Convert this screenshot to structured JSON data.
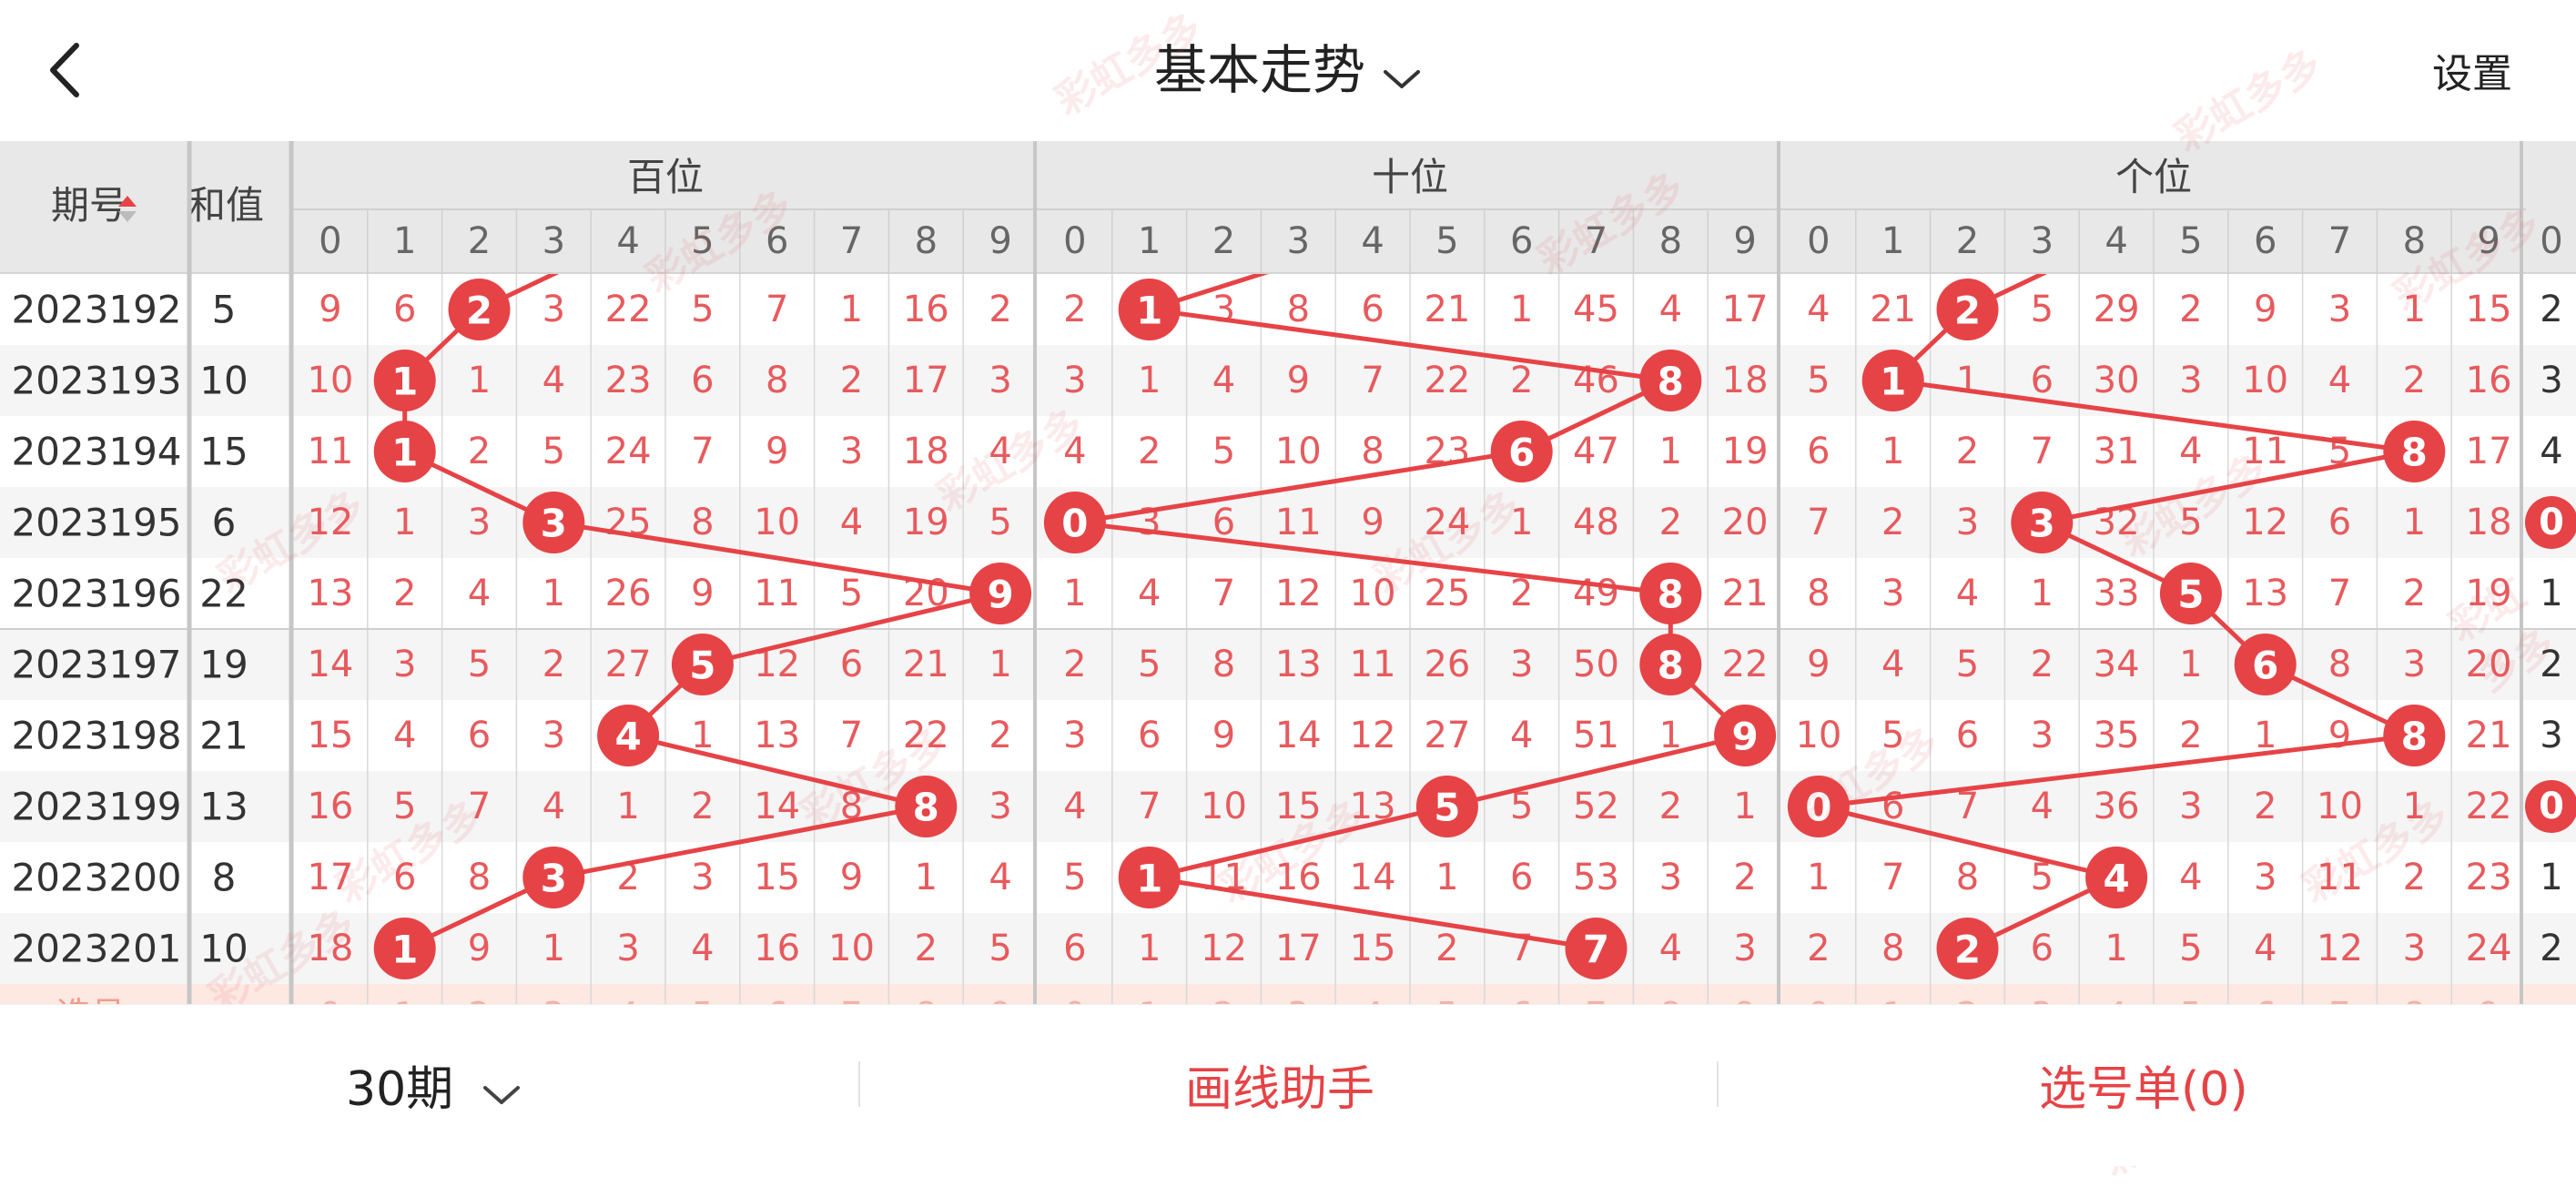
{
  "header": {
    "title": "基本走势",
    "settings_label": "设置"
  },
  "table": {
    "col_issue_label": "期号",
    "col_sum_label": "和值",
    "groups": [
      {
        "label": "百位"
      },
      {
        "label": "十位"
      },
      {
        "label": "个位"
      }
    ],
    "digits": [
      "0",
      "1",
      "2",
      "3",
      "4",
      "5",
      "6",
      "7",
      "8",
      "9"
    ],
    "partial_label": "选号",
    "rows": [
      {
        "issue": "2023192",
        "sum": "5",
        "hundreds": [
          9,
          6,
          2,
          3,
          22,
          5,
          7,
          1,
          16,
          2
        ],
        "tens": [
          2,
          1,
          3,
          8,
          6,
          21,
          1,
          45,
          4,
          17
        ],
        "units": [
          4,
          21,
          2,
          5,
          29,
          2,
          9,
          3,
          1,
          15
        ],
        "hit": [
          2,
          1,
          2
        ],
        "extra": "2"
      },
      {
        "issue": "2023193",
        "sum": "10",
        "hundreds": [
          10,
          1,
          1,
          4,
          23,
          6,
          8,
          2,
          17,
          3
        ],
        "tens": [
          3,
          1,
          4,
          9,
          7,
          22,
          2,
          46,
          8,
          18
        ],
        "units": [
          5,
          1,
          1,
          6,
          30,
          3,
          10,
          4,
          2,
          16
        ],
        "hit": [
          1,
          8,
          1
        ],
        "extra": "3"
      },
      {
        "issue": "2023194",
        "sum": "15",
        "hundreds": [
          11,
          1,
          2,
          5,
          24,
          7,
          9,
          3,
          18,
          4
        ],
        "tens": [
          4,
          2,
          5,
          10,
          8,
          23,
          6,
          47,
          1,
          19
        ],
        "units": [
          6,
          1,
          2,
          7,
          31,
          4,
          11,
          5,
          8,
          17
        ],
        "hit": [
          1,
          6,
          8
        ],
        "extra": "4"
      },
      {
        "issue": "2023195",
        "sum": "6",
        "hundreds": [
          12,
          1,
          3,
          3,
          25,
          8,
          10,
          4,
          19,
          5
        ],
        "tens": [
          0,
          3,
          6,
          11,
          9,
          24,
          1,
          48,
          2,
          20
        ],
        "units": [
          7,
          2,
          3,
          3,
          32,
          5,
          12,
          6,
          1,
          18
        ],
        "hit": [
          3,
          0,
          3
        ],
        "extra": "0"
      },
      {
        "issue": "2023196",
        "sum": "22",
        "hundreds": [
          13,
          2,
          4,
          1,
          26,
          9,
          11,
          5,
          20,
          9
        ],
        "tens": [
          1,
          4,
          7,
          12,
          10,
          25,
          2,
          49,
          8,
          21
        ],
        "units": [
          8,
          3,
          4,
          1,
          33,
          5,
          13,
          7,
          2,
          19
        ],
        "hit": [
          9,
          8,
          5
        ],
        "extra": "1"
      },
      {
        "issue": "2023197",
        "sum": "19",
        "hundreds": [
          14,
          3,
          5,
          2,
          27,
          5,
          12,
          6,
          21,
          1
        ],
        "tens": [
          2,
          5,
          8,
          13,
          11,
          26,
          3,
          50,
          8,
          22
        ],
        "units": [
          9,
          4,
          5,
          2,
          34,
          1,
          6,
          8,
          3,
          20
        ],
        "hit": [
          5,
          8,
          6
        ],
        "extra": "2"
      },
      {
        "issue": "2023198",
        "sum": "21",
        "hundreds": [
          15,
          4,
          6,
          3,
          4,
          1,
          13,
          7,
          22,
          2
        ],
        "tens": [
          3,
          6,
          9,
          14,
          12,
          27,
          4,
          51,
          1,
          9
        ],
        "units": [
          10,
          5,
          6,
          3,
          35,
          2,
          1,
          9,
          8,
          21
        ],
        "hit": [
          4,
          9,
          8
        ],
        "extra": "3"
      },
      {
        "issue": "2023199",
        "sum": "13",
        "hundreds": [
          16,
          5,
          7,
          4,
          1,
          2,
          14,
          8,
          8,
          3
        ],
        "tens": [
          4,
          7,
          10,
          15,
          13,
          5,
          5,
          52,
          2,
          1
        ],
        "units": [
          0,
          6,
          7,
          4,
          36,
          3,
          2,
          10,
          1,
          22
        ],
        "hit": [
          8,
          5,
          0
        ],
        "extra": "0"
      },
      {
        "issue": "2023200",
        "sum": "8",
        "hundreds": [
          17,
          6,
          8,
          3,
          2,
          3,
          15,
          9,
          1,
          4
        ],
        "tens": [
          5,
          1,
          11,
          16,
          14,
          1,
          6,
          53,
          3,
          2
        ],
        "units": [
          1,
          7,
          8,
          5,
          4,
          4,
          3,
          11,
          2,
          23
        ],
        "hit": [
          3,
          1,
          4
        ],
        "extra": "1"
      },
      {
        "issue": "2023201",
        "sum": "10",
        "hundreds": [
          18,
          1,
          9,
          1,
          3,
          4,
          16,
          10,
          2,
          5
        ],
        "tens": [
          6,
          1,
          12,
          17,
          15,
          2,
          7,
          7,
          4,
          3
        ],
        "units": [
          2,
          8,
          2,
          6,
          1,
          5,
          4,
          12,
          3,
          24
        ],
        "hit": [
          1,
          7,
          2
        ],
        "extra": "2"
      }
    ]
  },
  "bottom": {
    "period_label": "30期",
    "draw_helper_label": "画线助手",
    "pick_list_label": "选号单(0)"
  },
  "watermark": "彩虹多多",
  "colors": {
    "accent": "#e64346",
    "header_bg": "#e8e8e8",
    "row_alt": "#f5f5f5",
    "partial_row_bg": "#fde8e2",
    "grid_line": "#d8d8d8",
    "divider": "#c6c6c6",
    "text_dark": "#333333",
    "missing_text": "#e75a5d"
  }
}
